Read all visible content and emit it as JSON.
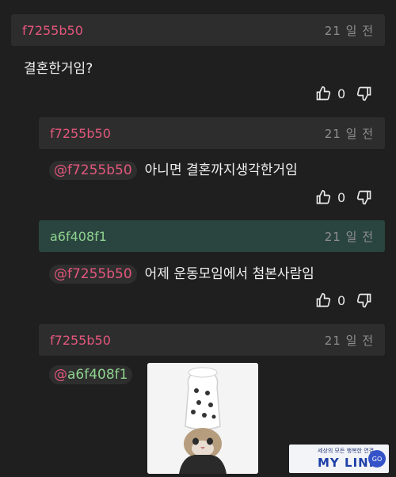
{
  "comments": [
    {
      "user": "f7255b50",
      "time": "21 일 전",
      "text": "결혼한거임?",
      "likes": "0"
    },
    {
      "user": "f7255b50",
      "time": "21 일 전",
      "mention": "f7255b50",
      "text": "아니면 결혼까지생각한거임",
      "likes": "0"
    },
    {
      "user": "a6f408f1",
      "time": "21 일 전",
      "mention": "f7255b50",
      "text": "어제 운동모임에서 첨본사람임",
      "likes": "0"
    },
    {
      "user": "f7255b50",
      "time": "21 일 전",
      "mention": "a6f408f1"
    }
  ],
  "ad": {
    "tagline": "세상의 모든 행복한 연결",
    "brand": "MY LINK",
    "go": "GO"
  },
  "colors": {
    "background": "#1f1f1f",
    "header": "#2d2d2d",
    "header_highlight": "#2a4540",
    "username_red": "#e3577c",
    "username_green": "#8fd38f"
  }
}
